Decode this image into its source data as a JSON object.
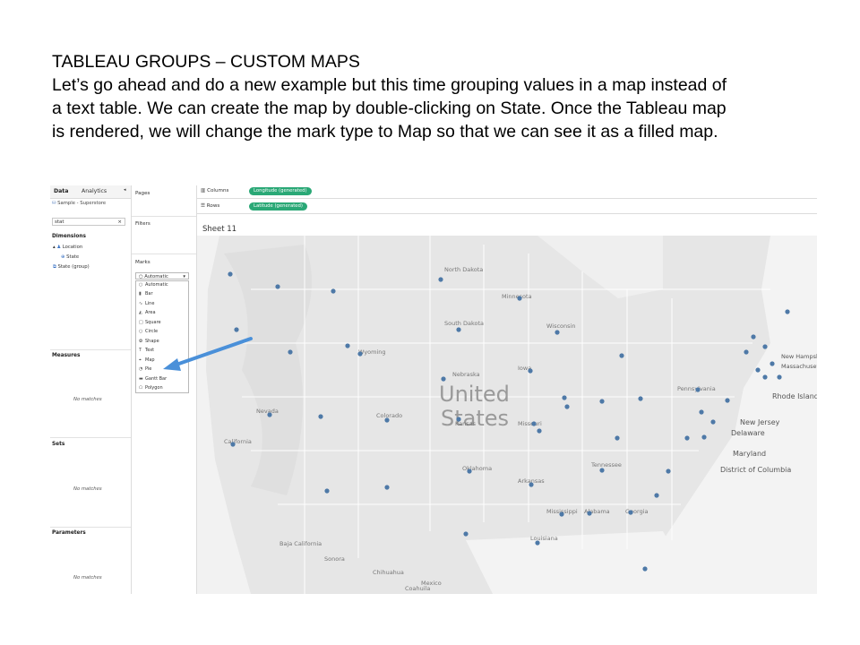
{
  "slide": {
    "heading": "TABLEAU GROUPS – CUSTOM MAPS",
    "lines": [
      "Let’s go ahead and do a new example but this time grouping values in a map instead of",
      "a text table. We can create the map by double-clicking on State. Once the Tableau map",
      "is rendered, we will change the mark type to Map so that we can see it as a filled map."
    ]
  },
  "tableau": {
    "data_tab": "Data",
    "analytics_tab": "Analytics",
    "datasource": "Sample - Superstore",
    "search_value": "stat",
    "search_clear": "×",
    "dimensions_label": "Dimensions",
    "dimension_items": [
      "Location",
      "State",
      "State (group)"
    ],
    "measures_label": "Measures",
    "sets_label": "Sets",
    "parameters_label": "Parameters",
    "no_matches": "No matches",
    "pages_label": "Pages",
    "filters_label": "Filters",
    "marks_label": "Marks",
    "marks_selected": "Automatic",
    "mark_types": [
      "Automatic",
      "Bar",
      "Line",
      "Area",
      "Square",
      "Circle",
      "Shape",
      "Text",
      "Map",
      "Pie",
      "Gantt Bar",
      "Polygon"
    ],
    "mark_icons": [
      "○",
      "▮",
      "∿",
      "◭",
      "□",
      "○",
      "✿",
      "T",
      "⌖",
      "◔",
      "▬",
      "⬠"
    ],
    "columns_label": "Columns",
    "columns_pill": "Longitude (generated)",
    "rows_label": "Rows",
    "rows_pill": "Latitude (generated)",
    "sheet_title": "Sheet 11"
  },
  "map_labels": {
    "country_line1": "United",
    "country_line2": "States",
    "states": [
      "North Dakota",
      "South Dakota",
      "Minnesota",
      "Wisconsin",
      "Wyoming",
      "Nebraska",
      "Iowa",
      "Kansas",
      "Missouri",
      "Oklahoma",
      "Arkansas",
      "Mississippi",
      "Alabama",
      "Georgia",
      "Tennessee",
      "Pennsylvania",
      "Nevada",
      "Colorado",
      "California",
      "Louisiana",
      "Mexico"
    ],
    "northeast": [
      "New Hampshire",
      "Massachusetts",
      "Rhode Island",
      "New Jersey",
      "Delaware",
      "Maryland",
      "District of Columbia"
    ],
    "baja": "Baja California",
    "sonora": "Sonora",
    "chihuahua": "Chihuahua",
    "coahuila": "Coahuila"
  },
  "colors": {
    "pill": "#2aa876",
    "dot": "#4e79a7",
    "arrow": "#4a90d9",
    "map_bg": "#e8e8e8"
  }
}
